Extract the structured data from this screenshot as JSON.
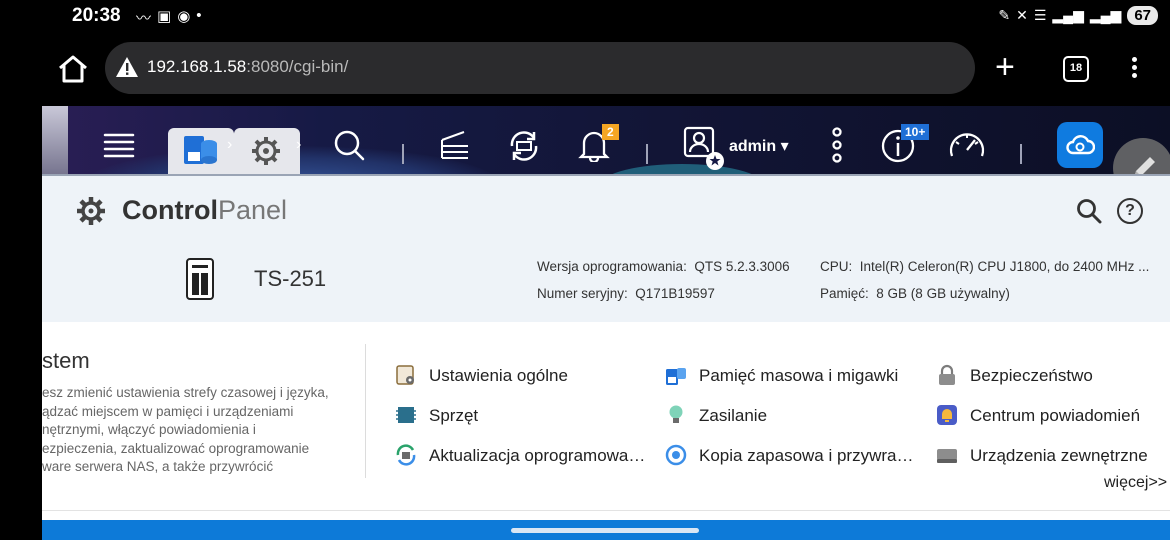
{
  "status_bar": {
    "time": "20:38",
    "battery": "67"
  },
  "browser": {
    "url_host": "192.168.1.58",
    "url_rest": ":8080/cgi-bin/",
    "tab_count": "18"
  },
  "qts_toolbar": {
    "notifications_badge": "2",
    "user": "admin",
    "updates_badge": "10+"
  },
  "control_panel": {
    "title_bold": "Control",
    "title_light": "Panel",
    "help_glyph": "?",
    "model": "TS-251",
    "firmware_label": "Wersja oprogramowania:",
    "firmware_value": "QTS 5.2.3.3006",
    "serial_label": "Numer seryjny:",
    "serial_value": "Q171B19597",
    "cpu_label": "CPU:",
    "cpu_value": "Intel(R) Celeron(R) CPU J1800, do 2400 MHz ...",
    "memory_label": "Pamięć:",
    "memory_value": "8 GB (8 GB używalny)"
  },
  "section": {
    "title": "stem",
    "description_lines": [
      "esz zmienić ustawienia strefy czasowej i języka,",
      "ądzać miejscem w pamięci i urządzeniami",
      "nętrznymi, włączyć powiadomienia i",
      "ezpieczenia, zaktualizować oprogramowanie",
      "ware serwera NAS, a także przywrócić"
    ],
    "links": [
      {
        "label": "Ustawienia ogólne",
        "icon": "general-settings-icon"
      },
      {
        "label": "Pamięć masowa i migawki",
        "icon": "storage-icon"
      },
      {
        "label": "Bezpieczeństwo",
        "icon": "lock-icon"
      },
      {
        "label": "Sprzęt",
        "icon": "hardware-icon"
      },
      {
        "label": "Zasilanie",
        "icon": "power-bulb-icon"
      },
      {
        "label": "Centrum powiadomień",
        "icon": "notification-center-icon"
      },
      {
        "label": "Aktualizacja oprogramowa…",
        "icon": "firmware-update-icon"
      },
      {
        "label": "Kopia zapasowa i przywra…",
        "icon": "backup-icon"
      },
      {
        "label": "Urządzenia zewnętrzne",
        "icon": "external-device-icon"
      }
    ],
    "more": "więcej>>"
  }
}
